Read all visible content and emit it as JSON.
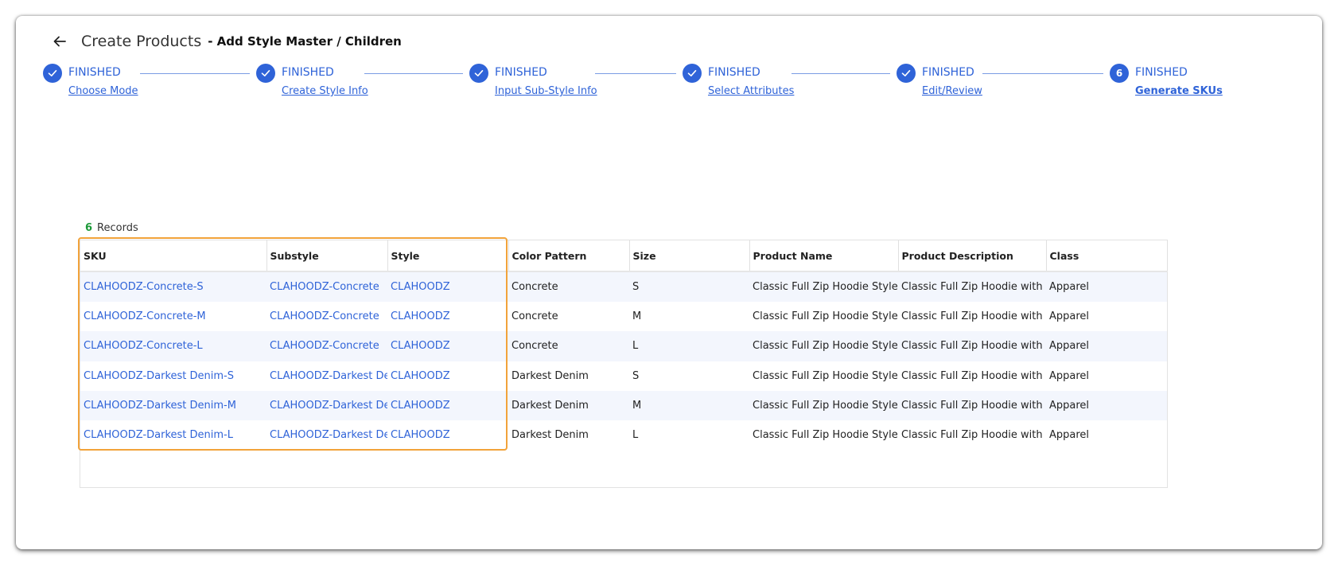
{
  "header": {
    "title": "Create Products",
    "subtitle": "- Add Style Master / Children"
  },
  "steps": [
    {
      "status": "FINISHED",
      "label": "Choose Mode",
      "icon": "check-icon"
    },
    {
      "status": "FINISHED",
      "label": "Create Style Info",
      "icon": "check-icon"
    },
    {
      "status": "FINISHED",
      "label": "Input Sub-Style Info",
      "icon": "check-icon"
    },
    {
      "status": "FINISHED",
      "label": "Select Attributes",
      "icon": "check-icon"
    },
    {
      "status": "FINISHED",
      "label": "Edit/Review",
      "icon": "check-icon"
    },
    {
      "status": "FINISHED",
      "label": "Generate SKUs",
      "number": "6"
    }
  ],
  "records": {
    "count": "6",
    "label": "Records"
  },
  "table": {
    "columns": [
      "SKU",
      "Substyle",
      "Style",
      "Color Pattern",
      "Size",
      "Product Name",
      "Product Description",
      "Class"
    ],
    "rows": [
      {
        "sku": "CLAHOODZ-Concrete-S",
        "substyle": "CLAHOODZ-Concrete",
        "style": "CLAHOODZ",
        "color": "Concrete",
        "size": "S",
        "name": "Classic Full Zip Hoodie Style",
        "desc": "Classic Full Zip Hoodie with Fle",
        "class": "Apparel"
      },
      {
        "sku": "CLAHOODZ-Concrete-M",
        "substyle": "CLAHOODZ-Concrete",
        "style": "CLAHOODZ",
        "color": "Concrete",
        "size": "M",
        "name": "Classic Full Zip Hoodie Style",
        "desc": "Classic Full Zip Hoodie with Fle",
        "class": "Apparel"
      },
      {
        "sku": "CLAHOODZ-Concrete-L",
        "substyle": "CLAHOODZ-Concrete",
        "style": "CLAHOODZ",
        "color": "Concrete",
        "size": "L",
        "name": "Classic Full Zip Hoodie Style",
        "desc": "Classic Full Zip Hoodie with Fle",
        "class": "Apparel"
      },
      {
        "sku": "CLAHOODZ-Darkest Denim-S",
        "substyle": "CLAHOODZ-Darkest Den",
        "style": "CLAHOODZ",
        "color": "Darkest Denim",
        "size": "S",
        "name": "Classic Full Zip Hoodie Style",
        "desc": "Classic Full Zip Hoodie with Fle",
        "class": "Apparel"
      },
      {
        "sku": "CLAHOODZ-Darkest Denim-M",
        "substyle": "CLAHOODZ-Darkest Den",
        "style": "CLAHOODZ",
        "color": "Darkest Denim",
        "size": "M",
        "name": "Classic Full Zip Hoodie Style",
        "desc": "Classic Full Zip Hoodie with Fle",
        "class": "Apparel"
      },
      {
        "sku": "CLAHOODZ-Darkest Denim-L",
        "substyle": "CLAHOODZ-Darkest Den",
        "style": "CLAHOODZ",
        "color": "Darkest Denim",
        "size": "L",
        "name": "Classic Full Zip Hoodie Style",
        "desc": "Classic Full Zip Hoodie with Fle",
        "class": "Apparel"
      }
    ]
  },
  "colors": {
    "accent": "#2f63d8",
    "highlight": "#f2a33a",
    "count": "#1e9a3a",
    "row_alt": "#f3f6fd"
  }
}
